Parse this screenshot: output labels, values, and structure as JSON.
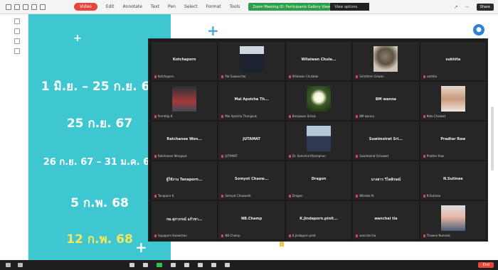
{
  "toolbar": {
    "record_label": "Video",
    "menu": [
      "Edit",
      "Annotate",
      "Text",
      "Pen",
      "Select",
      "Format",
      "Tools"
    ],
    "meeting_label": "Zoom Meeting ID: Participants Gallery View",
    "meeting_status": "View options",
    "share_label": "Share"
  },
  "slide": {
    "dates": [
      "1 มิ.ย. – 25 ก.ย. 67",
      "25 ก.ย. 67",
      "26 ก.ย. 67 – 31 ม.ค. 68",
      "5 ก.พ. 68",
      "12 ก.พ. 68"
    ],
    "highlight_color": "#f5e65b",
    "background": "#3ec7d1"
  },
  "gallery": {
    "tiles": [
      {
        "name": "Kotchaporn",
        "label": "Kotchaporn",
        "photo": ""
      },
      {
        "name": "",
        "label": "Pat Suwanchai",
        "photo": "ph1"
      },
      {
        "name": "Wilaiwan Chula...",
        "label": "Wilaiwan Chulalak",
        "photo": ""
      },
      {
        "name": "",
        "label": "Sirinthorn Sriwan",
        "photo": "ph2"
      },
      {
        "name": "sukhita",
        "label": "sukhita",
        "photo": ""
      },
      {
        "name": "",
        "label": "Pornthip K.",
        "photo": "ph3"
      },
      {
        "name": "Mai Apsicha Th...",
        "label": "Mai Apsicha Thongsuk",
        "photo": ""
      },
      {
        "name": "",
        "label": "Benjawan Srisuk",
        "photo": "ph4"
      },
      {
        "name": "BM wanna",
        "label": "BM wanna",
        "photo": ""
      },
      {
        "name": "",
        "label": "Nida Chaiwat",
        "photo": "ph5"
      },
      {
        "name": "Ratchanee Won...",
        "label": "Ratchanee Wongsuk",
        "photo": ""
      },
      {
        "name": "JUTAMAT",
        "label": "JUTAMAT",
        "photo": ""
      },
      {
        "name": "",
        "label": "Dr. Somchai Khamphan",
        "photo": "ph6"
      },
      {
        "name": "Suwimolrat Sri...",
        "label": "Suwimolrat Srisawat",
        "photo": ""
      },
      {
        "name": "Pradtar Raw",
        "label": "Pradtar Raw",
        "photo": ""
      },
      {
        "name": "ผู้ใช้งาน Tanaporn...",
        "label": "Tanaporn K.",
        "photo": ""
      },
      {
        "name": "Somyot Chaow...",
        "label": "Somyot Chaowalit",
        "photo": ""
      },
      {
        "name": "Dragon",
        "label": "Dragon",
        "photo": ""
      },
      {
        "name": "นางสาว วิไลลักษณ์",
        "label": "Wilailak N.",
        "photo": ""
      },
      {
        "name": "N.Sutinee",
        "label": "N.Sutinee",
        "photo": ""
      },
      {
        "name": "กษ.สุภาภรณ์ แก้วชา...",
        "label": "Supaporn Kaewchan",
        "photo": ""
      },
      {
        "name": "NB.Champ",
        "label": "NB.Champ",
        "photo": ""
      },
      {
        "name": "K.Jindaporn.pinit...",
        "label": "K.Jindaporn.pinit",
        "photo": ""
      },
      {
        "name": "wanchai tia",
        "label": "wanchai tia",
        "photo": ""
      },
      {
        "name": "",
        "label": "Thawee Numsak",
        "photo": "ph7"
      }
    ]
  },
  "bottombar": {
    "end_label": "End"
  }
}
